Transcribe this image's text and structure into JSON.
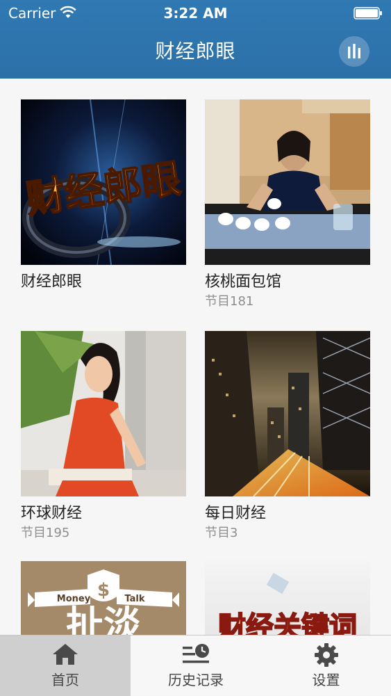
{
  "status_bar": {
    "carrier": "Carrier",
    "time": "3:22 AM"
  },
  "nav": {
    "title": "财经郎眼",
    "right_icon": "bars-icon"
  },
  "programs": [
    {
      "title": "财经郎眼",
      "count": "",
      "thumb_text": "财经郎眼"
    },
    {
      "title": "核桃面包馆",
      "count": "节目181"
    },
    {
      "title": "环球财经",
      "count": "节目195"
    },
    {
      "title": "每日财经",
      "count": "节目3"
    },
    {
      "title": "",
      "count": "",
      "thumb_text": "扯淡",
      "badge_left": "Money",
      "badge_right": "Talk"
    },
    {
      "title": "",
      "count": "",
      "thumb_text": "财经关键词"
    }
  ],
  "tabs": [
    {
      "label": "首页",
      "icon": "home-icon",
      "active": true
    },
    {
      "label": "历史记录",
      "icon": "history-icon",
      "active": false
    },
    {
      "label": "设置",
      "icon": "gear-icon",
      "active": false
    }
  ],
  "colors": {
    "nav_bg": "#2f76b0",
    "tab_active_bg": "#cfcfcf",
    "count_text": "#8e8e8e"
  }
}
